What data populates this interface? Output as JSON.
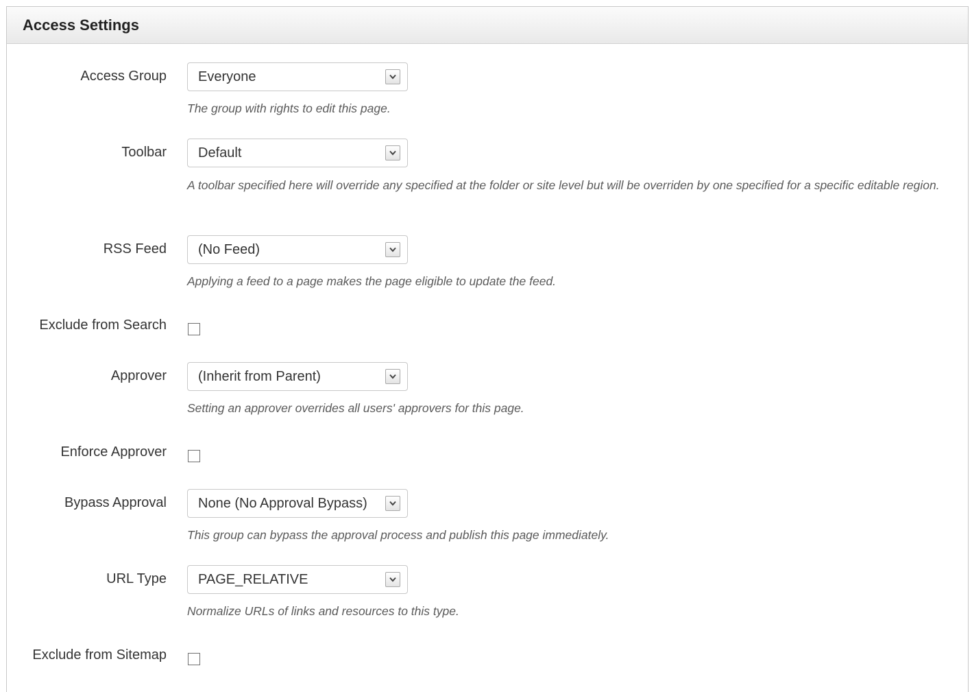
{
  "panel": {
    "title": "Access Settings"
  },
  "fields": {
    "access_group": {
      "label": "Access Group",
      "value": "Everyone",
      "help": "The group with rights to edit this page."
    },
    "toolbar": {
      "label": "Toolbar",
      "value": "Default",
      "help": "A toolbar specified here will override any specified at the folder or site level but will be overriden by one specified for a specific editable region."
    },
    "rss_feed": {
      "label": "RSS Feed",
      "value": "(No Feed)",
      "help": "Applying a feed to a page makes the page eligible to update the feed."
    },
    "exclude_from_search": {
      "label": "Exclude from Search",
      "checked": false
    },
    "approver": {
      "label": "Approver",
      "value": "(Inherit from Parent)",
      "help": "Setting an approver overrides all users' approvers for this page."
    },
    "enforce_approver": {
      "label": "Enforce Approver",
      "checked": false
    },
    "bypass_approval": {
      "label": "Bypass Approval",
      "value": "None (No Approval Bypass)",
      "help": "This group can bypass the approval process and publish this page immediately."
    },
    "url_type": {
      "label": "URL Type",
      "value": "PAGE_RELATIVE",
      "help": "Normalize URLs of links and resources to this type."
    },
    "exclude_from_sitemap": {
      "label": "Exclude from Sitemap",
      "checked": false
    }
  },
  "icons": {
    "dropdown": "chevron-down-icon"
  },
  "colors": {
    "header_bg": "#efefef",
    "border": "#c8c8c8",
    "help_text": "#5a5a5a",
    "label_text": "#333333"
  }
}
